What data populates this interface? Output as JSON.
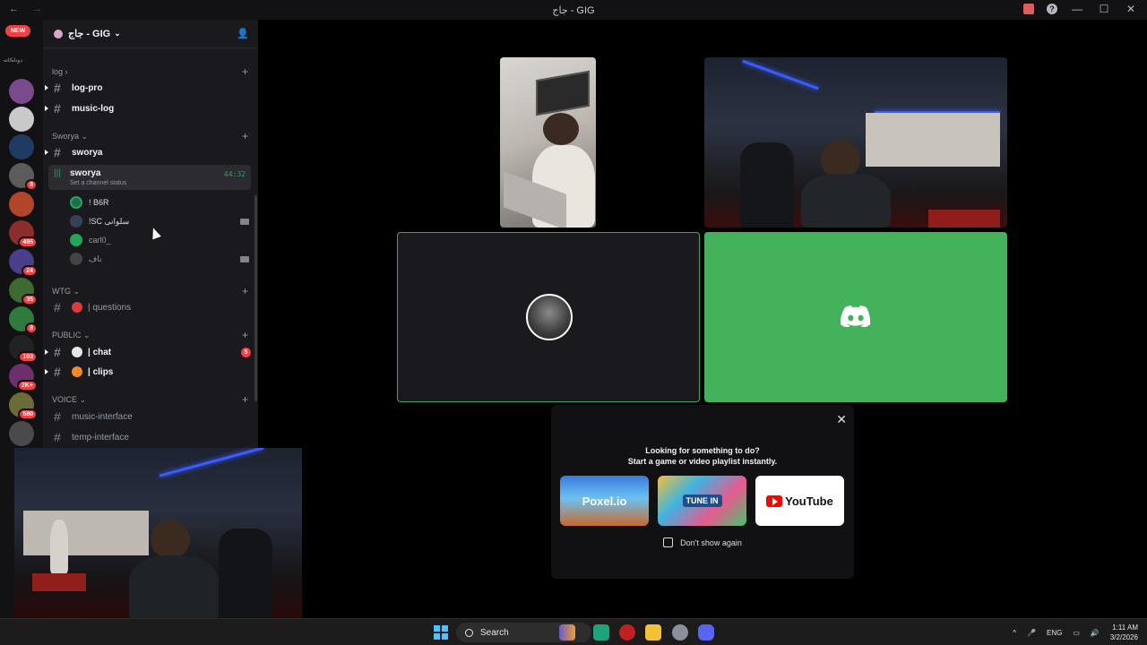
{
  "window": {
    "title": "جاج - GIG",
    "nav_back": "←",
    "nav_forward": "→",
    "minimize": "—",
    "maximize": "☐",
    "close": "✕"
  },
  "servers": {
    "new_label": "NEW",
    "folder_label": "ڊوتاڪاته",
    "badges": [
      "8",
      "495",
      "24",
      "35",
      "8",
      "103",
      "2K+",
      "580"
    ]
  },
  "guild": {
    "name": "جاج - GIG"
  },
  "categories": {
    "log": "log",
    "sworya": "Sworya",
    "wtg": "WTG",
    "public": "PUBLIC",
    "voice": "VOICE"
  },
  "channels": {
    "log_pro": "log-pro",
    "music_log": "music-log",
    "sworya_text": "sworya",
    "questions": "| questions",
    "chat": "| chat",
    "chat_badge": "5",
    "clips": "| clips",
    "music_interface": "music-interface",
    "temp_interface": "temp-interface"
  },
  "voice_channel": {
    "name": "sworya",
    "status": "Set a channel status",
    "timer": "44:32",
    "users": [
      "! B6R",
      "!SC سلوانى",
      "carl0_",
      "ناف"
    ]
  },
  "activity": {
    "heading1": "Looking for something to do?",
    "heading2": "Start a game or video playlist instantly.",
    "cards": [
      "Poxel.io",
      "TUNE IN",
      "YouTube"
    ],
    "dont_show": "Don't show again"
  },
  "taskbar": {
    "search": "Search",
    "lang": "ENG",
    "time": "1:11 AM",
    "date": "3/2/2026"
  }
}
